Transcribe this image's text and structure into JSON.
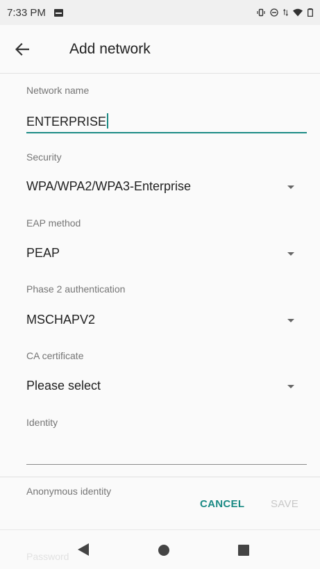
{
  "status_bar": {
    "time": "7:33 PM",
    "icons": [
      "notification-icon",
      "vibrate-icon",
      "dnd-icon",
      "data-arrows-icon",
      "wifi-icon",
      "battery-icon"
    ]
  },
  "app_bar": {
    "title": "Add network",
    "back_icon": "arrow-left-icon"
  },
  "form": {
    "network_name": {
      "label": "Network name",
      "value": "ENTERPRISE"
    },
    "security": {
      "label": "Security",
      "value": "WPA/WPA2/WPA3-Enterprise"
    },
    "eap_method": {
      "label": "EAP method",
      "value": "PEAP"
    },
    "phase2": {
      "label": "Phase 2 authentication",
      "value": "MSCHAPV2"
    },
    "ca_certificate": {
      "label": "CA certificate",
      "value": "Please select"
    },
    "identity": {
      "label": "Identity",
      "value": ""
    },
    "anonymous_identity": {
      "label": "Anonymous identity"
    },
    "password": {
      "label": "Password"
    }
  },
  "actions": {
    "cancel": "CANCEL",
    "save": "SAVE"
  },
  "colors": {
    "accent": "#1a8a84",
    "disabled": "#c8c8c8"
  }
}
